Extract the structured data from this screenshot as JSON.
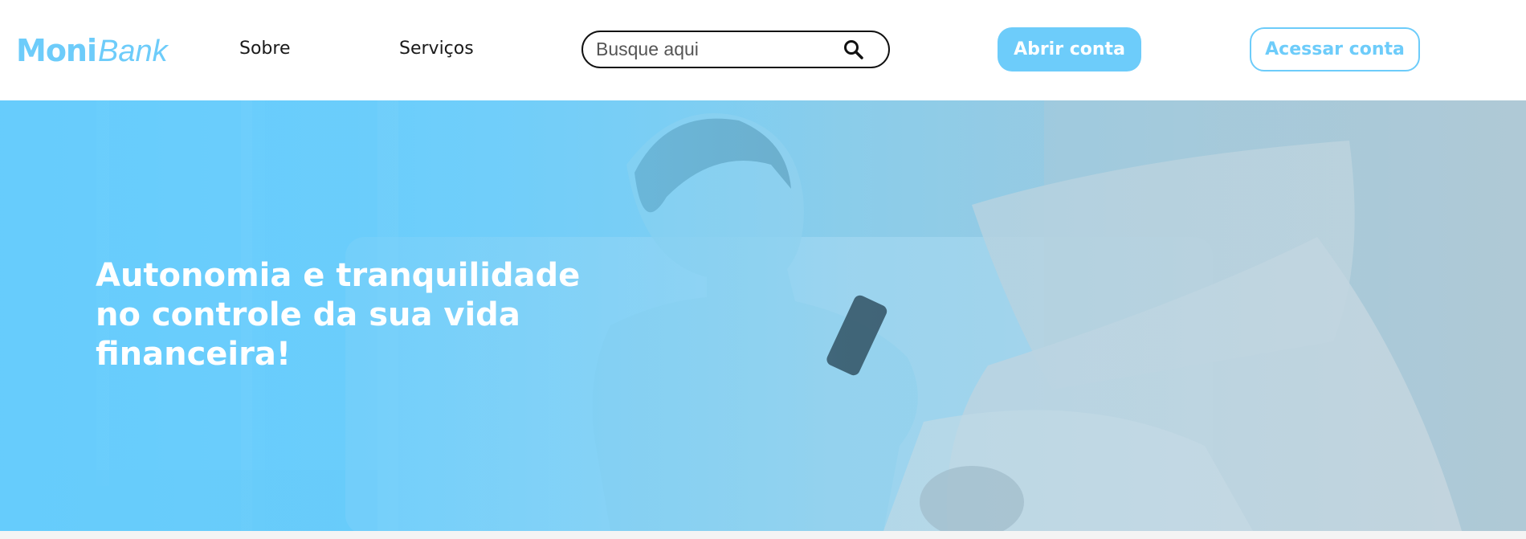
{
  "brand": {
    "name_bold": "Moni",
    "name_light": "Bank",
    "accent_color": "#6dccfa"
  },
  "nav": {
    "items": [
      {
        "label": "Sobre"
      },
      {
        "label": "Serviços"
      }
    ]
  },
  "search": {
    "placeholder": "Busque aqui",
    "value": "",
    "icon": "search-icon"
  },
  "actions": {
    "open_account": "Abrir conta",
    "access_account": "Acessar conta"
  },
  "hero": {
    "title_lines": [
      "Autonomia e tranquilidade",
      "no controle da sua vida",
      "financeira!"
    ],
    "overlay_color": "#66ccfc"
  }
}
